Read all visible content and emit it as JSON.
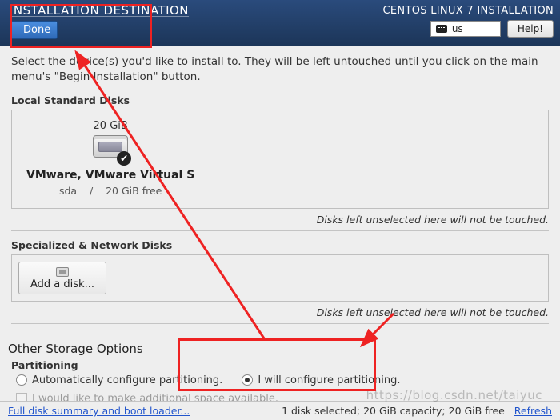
{
  "header": {
    "title": "INSTALLATION DESTINATION",
    "done_label": "Done",
    "product": "CENTOS LINUX 7 INSTALLATION",
    "keyboard_layout": "us",
    "help_label": "Help!"
  },
  "intro": "Select the device(s) you'd like to install to. They will be left untouched until you click on the main menu's \"Begin Installation\" button.",
  "sections": {
    "local_disks_label": "Local Standard Disks",
    "specialized_label": "Specialized & Network Disks",
    "unselected_note": "Disks left unselected here will not be touched."
  },
  "disk": {
    "capacity": "20 GiB",
    "name": "VMware, VMware Virtual S",
    "device": "sda",
    "separator": "/",
    "free": "20 GiB free"
  },
  "add_disk_label": "Add a disk...",
  "storage": {
    "heading": "Other Storage Options",
    "partitioning_label": "Partitioning",
    "radio_auto": "Automatically configure partitioning.",
    "radio_manual": "I will configure partitioning.",
    "checkbox_additional": "I would like to make additional space available."
  },
  "footer": {
    "summary_link": "Full disk summary and boot loader...",
    "status": "1 disk selected; 20 GiB capacity; 20 GiB free",
    "refresh_link": "Refresh"
  },
  "watermark": "https://blog.csdn.net/taiyuc"
}
